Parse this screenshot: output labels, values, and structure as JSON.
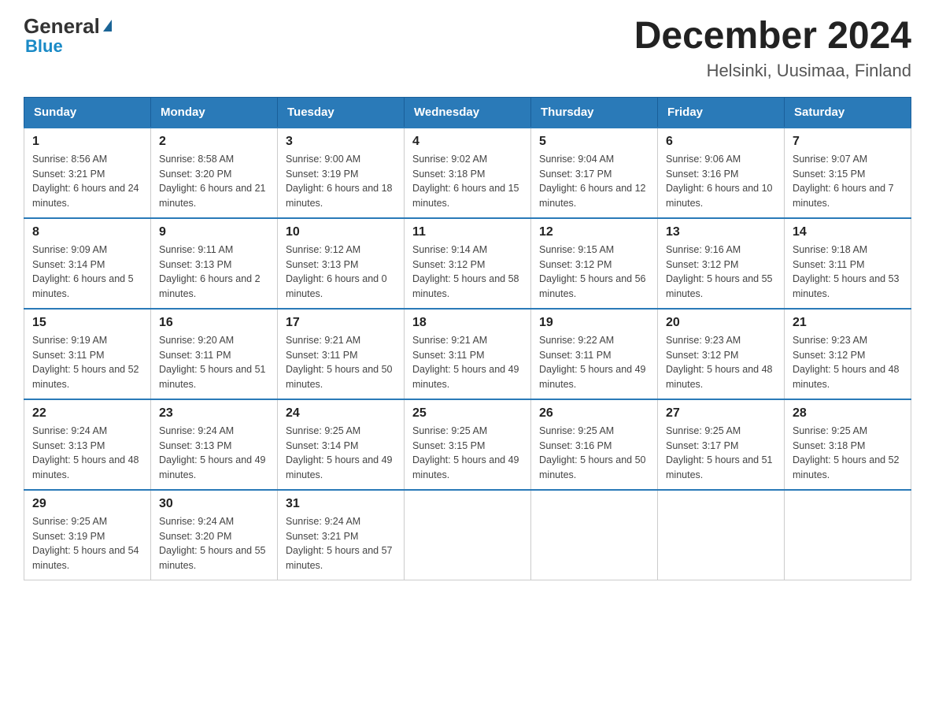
{
  "header": {
    "logo_general": "General",
    "logo_arrow": "▶",
    "logo_blue": "Blue",
    "month_year": "December 2024",
    "location": "Helsinki, Uusimaa, Finland"
  },
  "days_of_week": [
    "Sunday",
    "Monday",
    "Tuesday",
    "Wednesday",
    "Thursday",
    "Friday",
    "Saturday"
  ],
  "weeks": [
    [
      {
        "day": "1",
        "sunrise": "Sunrise: 8:56 AM",
        "sunset": "Sunset: 3:21 PM",
        "daylight": "Daylight: 6 hours and 24 minutes."
      },
      {
        "day": "2",
        "sunrise": "Sunrise: 8:58 AM",
        "sunset": "Sunset: 3:20 PM",
        "daylight": "Daylight: 6 hours and 21 minutes."
      },
      {
        "day": "3",
        "sunrise": "Sunrise: 9:00 AM",
        "sunset": "Sunset: 3:19 PM",
        "daylight": "Daylight: 6 hours and 18 minutes."
      },
      {
        "day": "4",
        "sunrise": "Sunrise: 9:02 AM",
        "sunset": "Sunset: 3:18 PM",
        "daylight": "Daylight: 6 hours and 15 minutes."
      },
      {
        "day": "5",
        "sunrise": "Sunrise: 9:04 AM",
        "sunset": "Sunset: 3:17 PM",
        "daylight": "Daylight: 6 hours and 12 minutes."
      },
      {
        "day": "6",
        "sunrise": "Sunrise: 9:06 AM",
        "sunset": "Sunset: 3:16 PM",
        "daylight": "Daylight: 6 hours and 10 minutes."
      },
      {
        "day": "7",
        "sunrise": "Sunrise: 9:07 AM",
        "sunset": "Sunset: 3:15 PM",
        "daylight": "Daylight: 6 hours and 7 minutes."
      }
    ],
    [
      {
        "day": "8",
        "sunrise": "Sunrise: 9:09 AM",
        "sunset": "Sunset: 3:14 PM",
        "daylight": "Daylight: 6 hours and 5 minutes."
      },
      {
        "day": "9",
        "sunrise": "Sunrise: 9:11 AM",
        "sunset": "Sunset: 3:13 PM",
        "daylight": "Daylight: 6 hours and 2 minutes."
      },
      {
        "day": "10",
        "sunrise": "Sunrise: 9:12 AM",
        "sunset": "Sunset: 3:13 PM",
        "daylight": "Daylight: 6 hours and 0 minutes."
      },
      {
        "day": "11",
        "sunrise": "Sunrise: 9:14 AM",
        "sunset": "Sunset: 3:12 PM",
        "daylight": "Daylight: 5 hours and 58 minutes."
      },
      {
        "day": "12",
        "sunrise": "Sunrise: 9:15 AM",
        "sunset": "Sunset: 3:12 PM",
        "daylight": "Daylight: 5 hours and 56 minutes."
      },
      {
        "day": "13",
        "sunrise": "Sunrise: 9:16 AM",
        "sunset": "Sunset: 3:12 PM",
        "daylight": "Daylight: 5 hours and 55 minutes."
      },
      {
        "day": "14",
        "sunrise": "Sunrise: 9:18 AM",
        "sunset": "Sunset: 3:11 PM",
        "daylight": "Daylight: 5 hours and 53 minutes."
      }
    ],
    [
      {
        "day": "15",
        "sunrise": "Sunrise: 9:19 AM",
        "sunset": "Sunset: 3:11 PM",
        "daylight": "Daylight: 5 hours and 52 minutes."
      },
      {
        "day": "16",
        "sunrise": "Sunrise: 9:20 AM",
        "sunset": "Sunset: 3:11 PM",
        "daylight": "Daylight: 5 hours and 51 minutes."
      },
      {
        "day": "17",
        "sunrise": "Sunrise: 9:21 AM",
        "sunset": "Sunset: 3:11 PM",
        "daylight": "Daylight: 5 hours and 50 minutes."
      },
      {
        "day": "18",
        "sunrise": "Sunrise: 9:21 AM",
        "sunset": "Sunset: 3:11 PM",
        "daylight": "Daylight: 5 hours and 49 minutes."
      },
      {
        "day": "19",
        "sunrise": "Sunrise: 9:22 AM",
        "sunset": "Sunset: 3:11 PM",
        "daylight": "Daylight: 5 hours and 49 minutes."
      },
      {
        "day": "20",
        "sunrise": "Sunrise: 9:23 AM",
        "sunset": "Sunset: 3:12 PM",
        "daylight": "Daylight: 5 hours and 48 minutes."
      },
      {
        "day": "21",
        "sunrise": "Sunrise: 9:23 AM",
        "sunset": "Sunset: 3:12 PM",
        "daylight": "Daylight: 5 hours and 48 minutes."
      }
    ],
    [
      {
        "day": "22",
        "sunrise": "Sunrise: 9:24 AM",
        "sunset": "Sunset: 3:13 PM",
        "daylight": "Daylight: 5 hours and 48 minutes."
      },
      {
        "day": "23",
        "sunrise": "Sunrise: 9:24 AM",
        "sunset": "Sunset: 3:13 PM",
        "daylight": "Daylight: 5 hours and 49 minutes."
      },
      {
        "day": "24",
        "sunrise": "Sunrise: 9:25 AM",
        "sunset": "Sunset: 3:14 PM",
        "daylight": "Daylight: 5 hours and 49 minutes."
      },
      {
        "day": "25",
        "sunrise": "Sunrise: 9:25 AM",
        "sunset": "Sunset: 3:15 PM",
        "daylight": "Daylight: 5 hours and 49 minutes."
      },
      {
        "day": "26",
        "sunrise": "Sunrise: 9:25 AM",
        "sunset": "Sunset: 3:16 PM",
        "daylight": "Daylight: 5 hours and 50 minutes."
      },
      {
        "day": "27",
        "sunrise": "Sunrise: 9:25 AM",
        "sunset": "Sunset: 3:17 PM",
        "daylight": "Daylight: 5 hours and 51 minutes."
      },
      {
        "day": "28",
        "sunrise": "Sunrise: 9:25 AM",
        "sunset": "Sunset: 3:18 PM",
        "daylight": "Daylight: 5 hours and 52 minutes."
      }
    ],
    [
      {
        "day": "29",
        "sunrise": "Sunrise: 9:25 AM",
        "sunset": "Sunset: 3:19 PM",
        "daylight": "Daylight: 5 hours and 54 minutes."
      },
      {
        "day": "30",
        "sunrise": "Sunrise: 9:24 AM",
        "sunset": "Sunset: 3:20 PM",
        "daylight": "Daylight: 5 hours and 55 minutes."
      },
      {
        "day": "31",
        "sunrise": "Sunrise: 9:24 AM",
        "sunset": "Sunset: 3:21 PM",
        "daylight": "Daylight: 5 hours and 57 minutes."
      },
      null,
      null,
      null,
      null
    ]
  ]
}
